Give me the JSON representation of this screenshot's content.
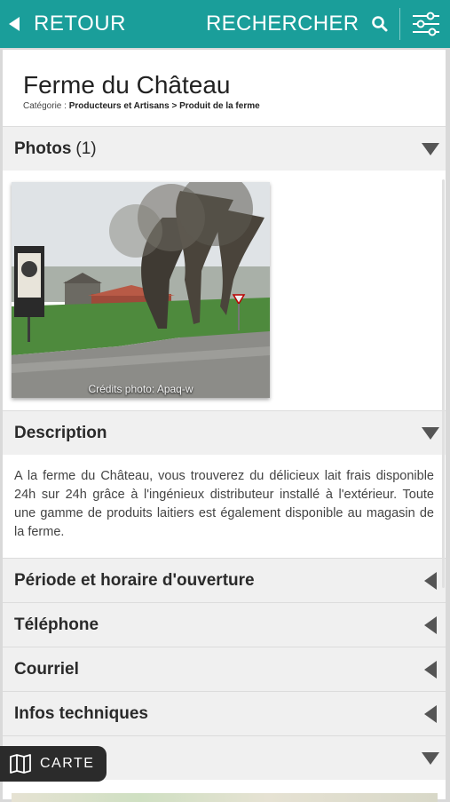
{
  "colors": {
    "topbar": "#1a9e9a",
    "section_bg": "#f0f0f0",
    "carte_bg": "#2b2b2b"
  },
  "topbar": {
    "back_label": "RETOUR",
    "search_label": "RECHERCHER",
    "icons": [
      "back-arrow-icon",
      "search-icon",
      "filter-sliders-icon"
    ]
  },
  "header": {
    "title": "Ferme du Château",
    "category_prefix": "Catégorie :",
    "category_path": "Producteurs et Artisans > Produit de la ferme"
  },
  "photos": {
    "label": "Photos",
    "count": "(1)",
    "credit": "Crédits photo: Apaq-w"
  },
  "description": {
    "label": "Description",
    "text": "A la ferme du Château, vous trouverez du délicieux lait frais disponible 24h sur 24h grâce à l'ingénieux distributeur installé à l'extérieur. Toute une gamme de produits laitiers est également disponible au magasin de la ferme."
  },
  "sections": [
    {
      "label": "Période et horaire d'ouverture",
      "state": "collapsed"
    },
    {
      "label": "Téléphone",
      "state": "collapsed"
    },
    {
      "label": "Courriel",
      "state": "collapsed"
    },
    {
      "label": "Infos techniques",
      "state": "collapsed"
    }
  ],
  "carte": {
    "label": "CARTE",
    "icon": "map-icon"
  }
}
